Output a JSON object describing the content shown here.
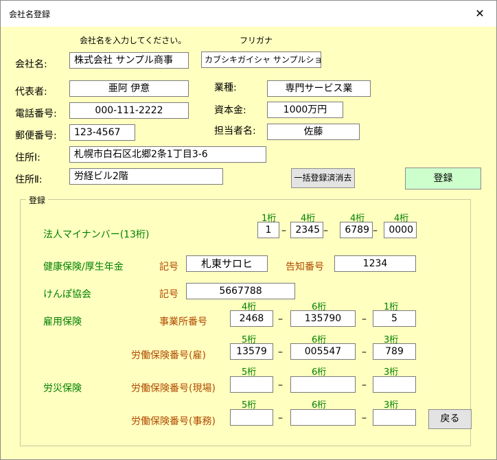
{
  "window": {
    "title": "会社名登録",
    "close_symbol": "✕"
  },
  "header": {
    "company_hint": "会社名を入力してください。",
    "furigana_hint": "フリガナ",
    "company_label": "会社名:",
    "company_value": "株式会社 サンプル商事",
    "furigana_value": "カブシキガイシャ サンプルショウジ"
  },
  "fields": {
    "representative_label": "代表者:",
    "representative_value": "亜阿 伊意",
    "industry_label": "業種:",
    "industry_value": "専門サービス業",
    "phone_label": "電話番号:",
    "phone_value": "000-111-2222",
    "capital_label": "資本金:",
    "capital_value": "1000万円",
    "postal_label": "郵便番号:",
    "postal_value": "123-4567",
    "contact_label": "担当者名:",
    "contact_value": "佐藤",
    "address1_label": "住所Ⅰ:",
    "address1_value": "札幌市白石区北郷2条1丁目3-6",
    "address2_label": "住所Ⅱ:",
    "address2_value": "労経ビル2階"
  },
  "buttons": {
    "clear_all": "一括登録済消去",
    "register": "登録",
    "back": "戻る"
  },
  "registration": {
    "frame_title": "登録",
    "mynumber": {
      "label": "法人マイナンバー(13桁)",
      "digits": [
        "1桁",
        "4桁",
        "4桁",
        "4桁"
      ],
      "values": [
        "1",
        "2345",
        "6789",
        "0000"
      ]
    },
    "health": {
      "label": "健康保険/厚生年金",
      "symbol_label": "記号",
      "symbol_value": "札東サロヒ",
      "notice_label": "告知番号",
      "notice_value": "1234"
    },
    "kenpo": {
      "label": "けんぽ協会",
      "symbol_label": "記号",
      "symbol_value": "5667788"
    },
    "employment": {
      "label": "雇用保険",
      "office_label": "事業所番号",
      "digits": [
        "4桁",
        "6桁",
        "1桁"
      ],
      "values": [
        "2468",
        "135790",
        "5"
      ]
    },
    "labor_employ": {
      "label": "労働保険番号(雇)",
      "digits": [
        "5桁",
        "6桁",
        "3桁"
      ],
      "values": [
        "13579",
        "005547",
        "789"
      ]
    },
    "workers_comp": {
      "label": "労災保険",
      "site_label": "労働保険番号(現場)",
      "site_digits": [
        "5桁",
        "6桁",
        "3桁"
      ],
      "site_values": [
        "",
        "",
        ""
      ],
      "office_label": "労働保険番号(事務)",
      "office_digits": [
        "5桁",
        "6桁",
        "3桁"
      ],
      "office_values": [
        "",
        "",
        ""
      ]
    },
    "dash": "–"
  }
}
